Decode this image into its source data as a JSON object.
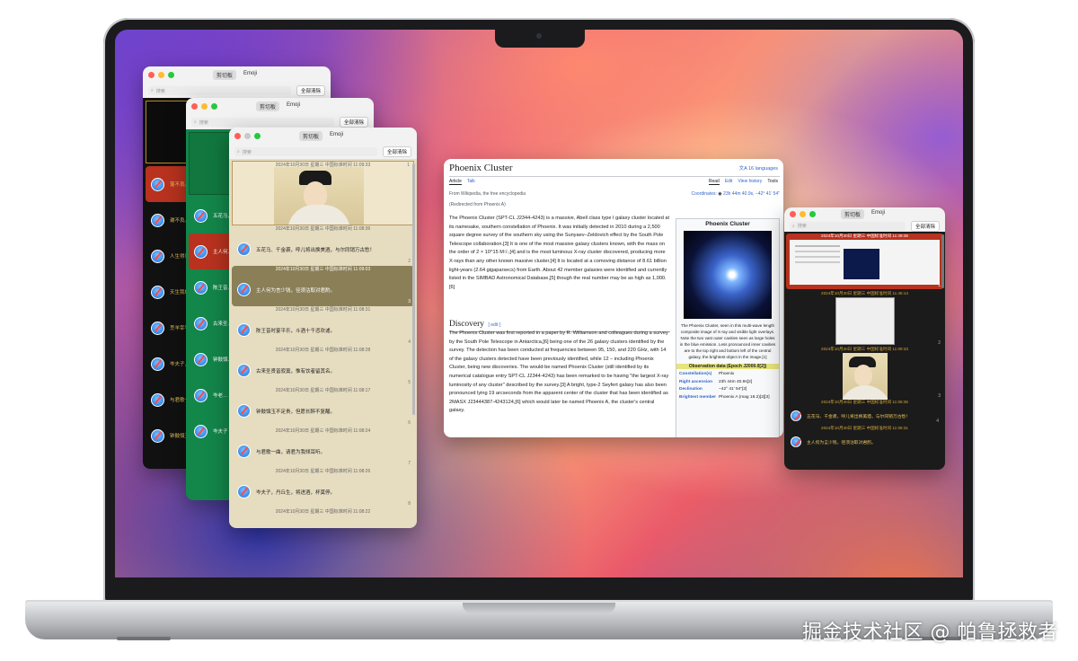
{
  "watermark": "掘金技术社区 @ 帕鲁拯救者",
  "clipboard": {
    "tab_clipboard": "剪切板",
    "tab_emoji": "Emoji",
    "search_placeholder": "搜索",
    "clear_all": "全部清除"
  },
  "win1": {
    "items": [
      {
        "text": "蓬不良。",
        "num": ""
      },
      {
        "text": "谢不良。",
        "num": ""
      },
      {
        "text": "人生得意…",
        "num": ""
      },
      {
        "text": "天生我材…",
        "num": ""
      },
      {
        "text": "烹羊宰牛…",
        "num": ""
      },
      {
        "text": "岑夫子，",
        "num": ""
      },
      {
        "text": "与君歌一…",
        "num": ""
      },
      {
        "text": "钟鼓馔玉…",
        "num": ""
      }
    ]
  },
  "win2": {
    "items": [
      {
        "text": "五花马、",
        "num": ""
      },
      {
        "text": "主人何…",
        "num": ""
      },
      {
        "text": "陈王昔…",
        "num": ""
      },
      {
        "text": "古来圣…",
        "num": ""
      },
      {
        "text": "钟鼓馔…",
        "num": ""
      },
      {
        "text": "岑老…",
        "num": ""
      },
      {
        "text": "岑夫子",
        "num": ""
      }
    ]
  },
  "win3": {
    "items": [
      {
        "ts": "2024年10月30日 星期三 中国标准时间 11:09:33",
        "text": "",
        "num": "1",
        "image": true
      },
      {
        "ts": "2024年10月30日 星期三 中国标准时间 11:08:36",
        "text": "五花马、千金裘，呼儿将出换美酒，与尔同销万古愁！",
        "num": "2"
      },
      {
        "ts": "2024年10月30日 星期三 中国标准时间 11:09:03",
        "text": "主人何为言少钱，径须沽取对君酌。",
        "num": "3",
        "selected": true
      },
      {
        "ts": "2024年10月30日 星期三 中国标准时间 11:08:31",
        "text": "陈王昔时宴平乐，斗酒十千恣欢谑。",
        "num": "4"
      },
      {
        "ts": "2024年10月30日 星期三 中国标准时间 11:08:28",
        "text": "古来圣贤皆寂寞，惟有饮者留其名。",
        "num": "5"
      },
      {
        "ts": "2024年10月30日 星期三 中国标准时间 11:08:17",
        "text": "钟鼓馔玉不足贵，但愿长醉不复醒。",
        "num": "6"
      },
      {
        "ts": "2024年10月30日 星期三 中国标准时间 11:08:24",
        "text": "与君歌一曲，请君为我倾耳听。",
        "num": "7"
      },
      {
        "ts": "2024年10月30日 星期三 中国标准时间 11:08:26",
        "text": "岑夫子，丹丘生，将进酒，杯莫停。",
        "num": "8"
      },
      {
        "ts": "2024年10月30日 星期三 中国标准时间 11:08:22",
        "text": "",
        "num": ""
      }
    ]
  },
  "win4": {
    "ts1": "2024年10月30日 星期三 中国标准时间 11:49:35",
    "ts2": "2024年10月30日 星期三 中国标准时间 11:45:14",
    "ts3": "2024年10月30日 星期三 中国标准时间 11:09:33",
    "ts4": "2024年10月30日 星期三 中国标准时间 11:08:35",
    "ts5": "2024年10月30日 星期三 中国标准时间 11:08:31",
    "item4_text": "五花马、千金裘，呼儿将出换美酒，与尔同销万古愁！",
    "item5_text": "主人何为言少钱，径须沽取对君酌。",
    "num1": "1",
    "num2": "2",
    "num3": "3",
    "num4": "4"
  },
  "wiki": {
    "title": "Phoenix Cluster",
    "languages": "16 languages",
    "tab_article": "Article",
    "tab_talk": "Talk",
    "tab_read": "Read",
    "tab_edit": "Edit",
    "tab_history": "View history",
    "tab_tools": "Tools",
    "from": "From Wikipedia, the free encyclopedia",
    "redirected": "(Redirected from Phoenix A)",
    "coordinates_label": "Coordinates:",
    "coordinates": "23h 44m 40.9s, −42° 41′ 54″",
    "intro": "The Phoenix Cluster (SPT-CL J2344-4243) is a massive, Abell class type I galaxy cluster located at its namesake, southern constellation of Phoenix. It was initially detected in 2010 during a 2,500 square degree survey of the southern sky using the Sunyaev–Zeldovich effect by the South Pole Telescope collaboration.[3] It is one of the most massive galaxy clusters known, with the mass on the order of 2 × 10^15 M☉,[4] and is the most luminous X-ray cluster discovered, producing more X-rays than any other known massive cluster.[4] It is located at a comoving distance of 8.61 billion light-years (2.64 gigaparsecs) from Earth. About 42 member galaxies were identified and currently listed in the SIMBAD Astronomical Database,[5] though the real number may be as high as 1,000.[6]",
    "discovery_heading": "Discovery",
    "discovery_edit": "[ edit ]",
    "discovery": "The Phoenix Cluster was first reported in a paper by R. Williamson and colleagues during a survey by the South Pole Telescope in Antarctica,[6] being one of the 26 galaxy clusters identified by the survey. The detection has been conducted at frequencies between 95, 150, and 220 GHz, with 14 of the galaxy clusters detected have been previously identified, while 12 – including Phoenix Cluster, being new discoveries. The would-be named Phoenix Cluster (still identified by its numerical catalogue entry SPT-CL J2344-4243) has been remarked to be having \"the largest X-ray luminosity of any cluster\" described by the survey.[3] A bright, type-2 Seyfert galaxy has also been pronounced lying 19 arcseconds from the apparent center of the cluster that has been identified as 2MASX J23444387-4243124,[6] which would later be named Phoenix A, the cluster's central galaxy.",
    "infobox_title": "Phoenix Cluster",
    "infobox_caption": "The Phoenix Cluster, seen in this multi-wave length composite image of X-ray and visible light overlays. Note the two vast outer cavities seen as large holes in the blue emission. Less pronounced inner cavities are to the top right and bottom left of the central galaxy, the brightest object in the image.[1]",
    "obs_data": "Observation data (Epoch J2000.0[2])",
    "rows": [
      {
        "k": "Constellation(s)",
        "v": "Phoenix"
      },
      {
        "k": "Right ascension",
        "v": "23h 44m 40.9s[2]"
      },
      {
        "k": "Declination",
        "v": "−42° 41′ 54″[2]"
      },
      {
        "k": "Brightest member",
        "v": "Phoenix A (mag 18.2)[2][3]"
      }
    ]
  },
  "colors": {
    "clip_bg": "#e6dcc0",
    "win1_bg": "#111111",
    "win2_bg": "#13864a",
    "selected_olive": "#8a7f57",
    "red_item": "#b8321f"
  }
}
